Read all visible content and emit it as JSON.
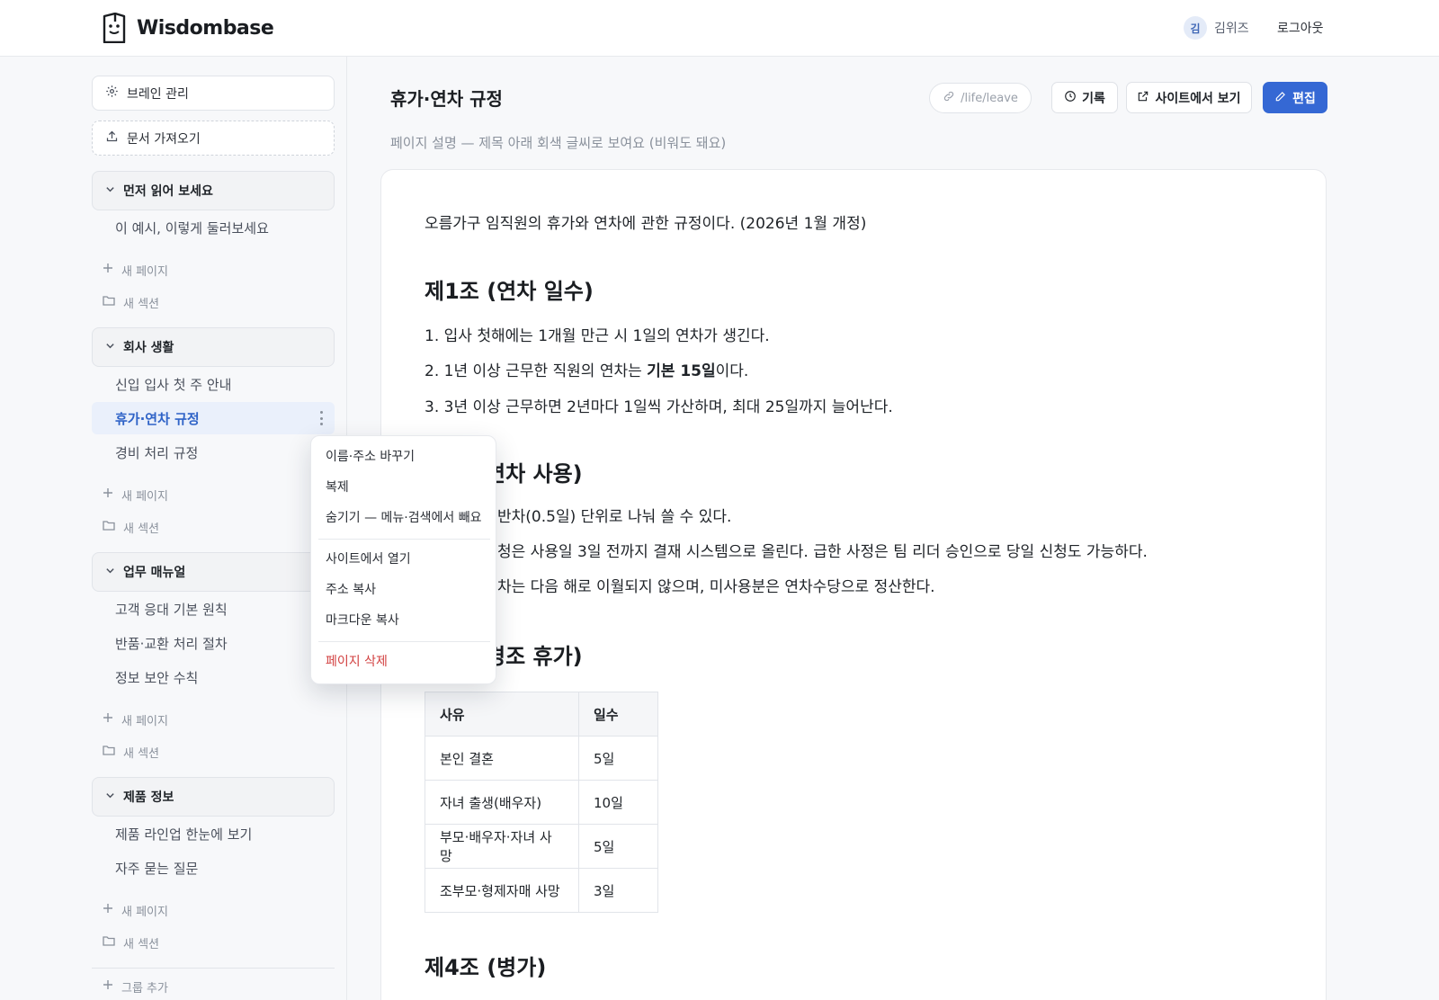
{
  "header": {
    "brand": "Wisdombase",
    "user": {
      "avatar_initial": "김",
      "name": "김위즈"
    },
    "logout": "로그아웃"
  },
  "sidebar": {
    "brain_settings": "브레인 관리",
    "import_docs": "문서 가져오기",
    "groups": [
      {
        "title": "먼저 읽어 보세요",
        "items": [
          "이 예시, 이렇게 둘러보세요"
        ]
      },
      {
        "title": "회사 생활",
        "items": [
          "신입 입사 첫 주 안내",
          "휴가·연차 규정",
          "경비 처리 규정"
        ],
        "active_index": 1
      },
      {
        "title": "업무 매뉴얼",
        "items": [
          "고객 응대 기본 원칙",
          "반품·교환 처리 절차",
          "정보 보안 수칙"
        ]
      },
      {
        "title": "제품 정보",
        "items": [
          "제품 라인업 한눈에 보기",
          "자주 묻는 질문"
        ]
      }
    ],
    "new_page": "새 페이지",
    "new_section": "새 섹션",
    "add_group": "그룹 추가"
  },
  "page": {
    "title": "휴가·연차 규정",
    "description": "페이지 설명 — 제목 아래 회색 글씨로 보여요 (비워도 돼요)",
    "path": "/life/leave",
    "history_button": "기록",
    "view_site_button": "사이트에서 보기",
    "edit_button": "편집"
  },
  "doc": {
    "intro": "오름가구 임직원의 휴가와 연차에 관한 규정이다. (2026년 1월 개정)",
    "sections": [
      {
        "heading": "제1조 (연차 일수)",
        "items": [
          {
            "num": "1.",
            "text": "입사 첫해에는 1개월 만근 시 1일의 연차가 생긴다."
          },
          {
            "num": "2.",
            "before": "1년 이상 근무한 직원의 연차는 ",
            "bold": "기본 15일",
            "after": "이다."
          },
          {
            "num": "3.",
            "text": "3년 이상 근무하면 2년마다 1일씩 가산하며, 최대 25일까지 늘어난다."
          }
        ]
      },
      {
        "heading_visible": "연차 사용)",
        "items_visible": [
          "반차(0.5일) 단위로 나눠 쓸 수 있다.",
          "청은 사용일 3일 전까지 결재 시스템으로 올린다. 급한 사정은 팀 리더 승인으로 당일 신청도 가능하다.",
          "차는 다음 해로 이월되지 않으며, 미사용분은 연차수당으로 정산한다."
        ]
      },
      {
        "heading_visible": "경조 휴가)",
        "table": {
          "headers": [
            "사유",
            "일수"
          ],
          "rows": [
            [
              "본인 결혼",
              "5일"
            ],
            [
              "자녀 출생(배우자)",
              "10일"
            ],
            [
              "부모·배우자·자녀 사망",
              "5일"
            ],
            [
              "조부모·형제자매 사망",
              "3일"
            ]
          ]
        }
      },
      {
        "heading": "제4조 (병가)"
      }
    ]
  },
  "context_menu": {
    "rename": "이름·주소 바꾸기",
    "duplicate": "복제",
    "hide": "숨기기 — 메뉴·검색에서 빼요",
    "open_site": "사이트에서 열기",
    "copy_url": "주소 복사",
    "copy_markdown": "마크다운 복사",
    "delete": "페이지 삭제"
  },
  "colors": {
    "accent": "#3568d4",
    "active_nav_bg": "#eaf0fb",
    "danger": "#d24040"
  },
  "icons": [
    "brand-logo-icon",
    "gear-icon",
    "upload-icon",
    "chevron-down-icon",
    "plus-icon",
    "folder-icon",
    "link-icon",
    "clock-icon",
    "external-link-icon",
    "pencil-icon",
    "kebab-icon"
  ]
}
